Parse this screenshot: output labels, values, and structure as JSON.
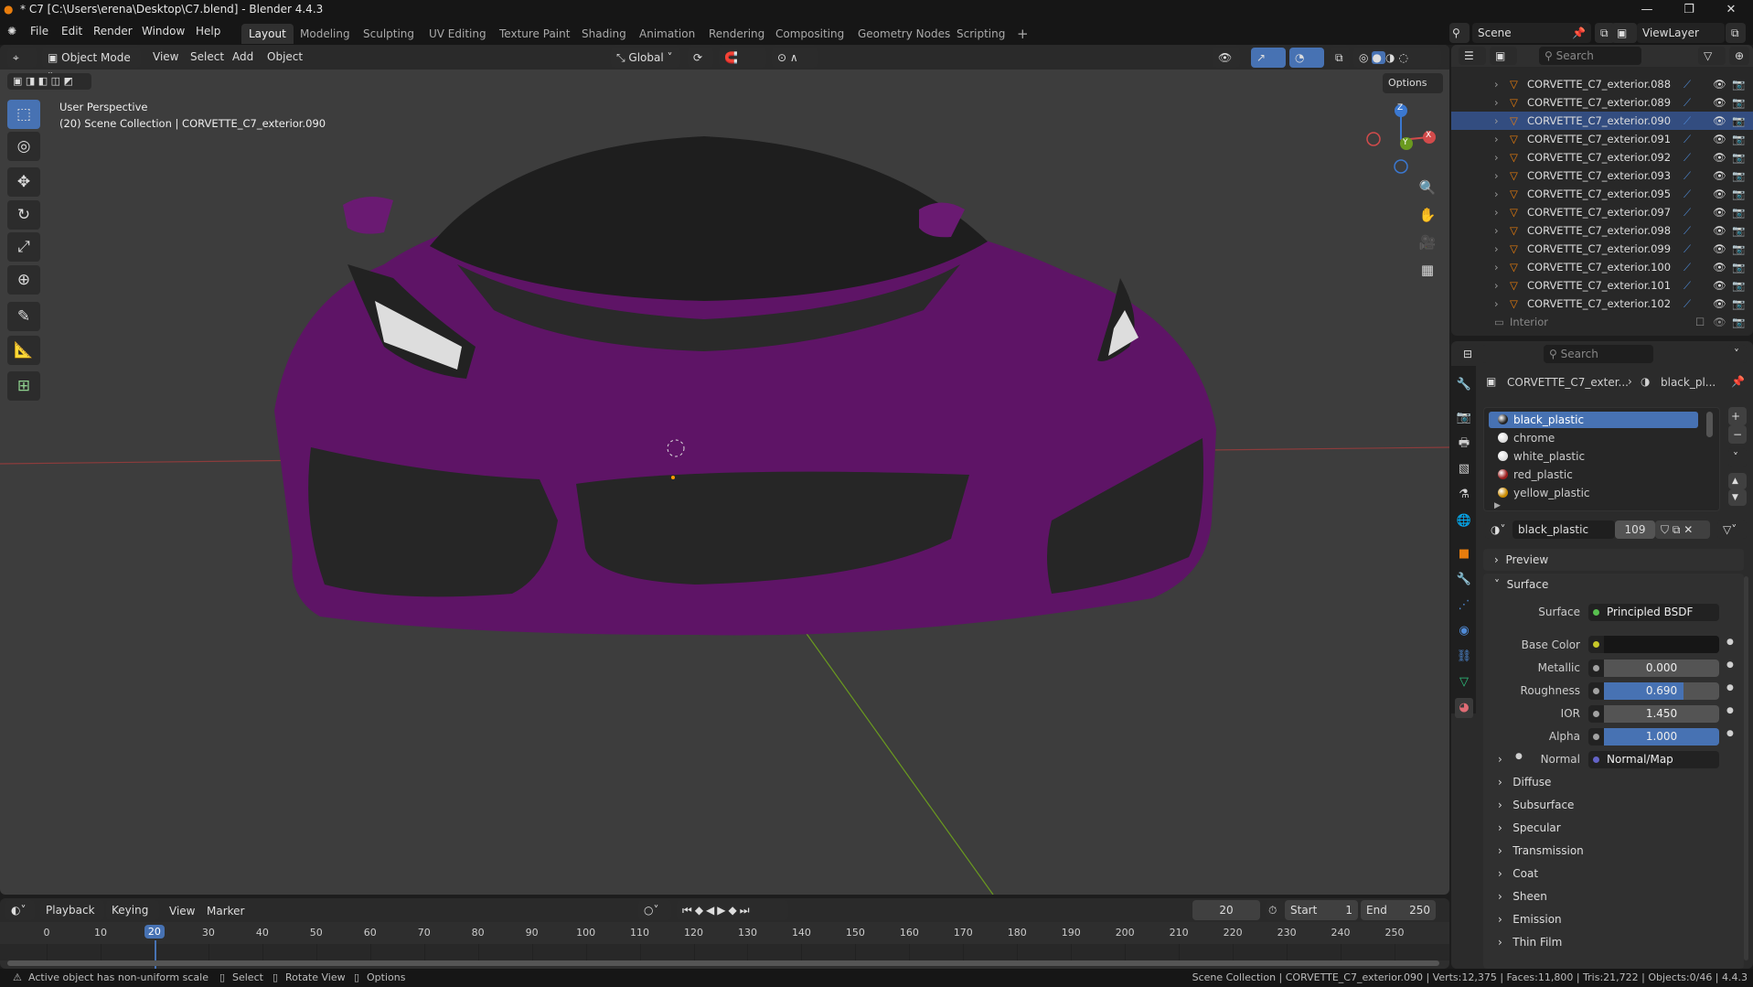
{
  "window": {
    "title": "* C7 [C:\\Users\\erena\\Desktop\\C7.blend] - Blender 4.4.3"
  },
  "menu": [
    "File",
    "Edit",
    "Render",
    "Window",
    "Help"
  ],
  "workspaces": [
    "Layout",
    "Modeling",
    "Sculpting",
    "UV Editing",
    "Texture Paint",
    "Shading",
    "Animation",
    "Rendering",
    "Compositing",
    "Geometry Nodes",
    "Scripting"
  ],
  "active_workspace": "Layout",
  "scene": {
    "name": "Scene",
    "view_layer": "ViewLayer"
  },
  "viewport": {
    "mode": "Object Mode",
    "menus": [
      "View",
      "Select",
      "Add",
      "Object"
    ],
    "orientation": "Global",
    "options": "Options",
    "overlay_title": "User Perspective",
    "overlay_subtitle": "(20) Scene Collection | CORVETTE_C7_exterior.090",
    "axes": {
      "x": "X",
      "y": "Y",
      "z": "Z"
    },
    "colors": {
      "car_paint": "#5e1466",
      "x_axis": "#9b3a3a",
      "y_axis": "#6a9a1f"
    }
  },
  "outliner": {
    "search_placeholder": "Search",
    "items": [
      "CORVETTE_C7_exterior.088",
      "CORVETTE_C7_exterior.089",
      "CORVETTE_C7_exterior.090",
      "CORVETTE_C7_exterior.091",
      "CORVETTE_C7_exterior.092",
      "CORVETTE_C7_exterior.093",
      "CORVETTE_C7_exterior.095",
      "CORVETTE_C7_exterior.097",
      "CORVETTE_C7_exterior.098",
      "CORVETTE_C7_exterior.099",
      "CORVETTE_C7_exterior.100",
      "CORVETTE_C7_exterior.101",
      "CORVETTE_C7_exterior.102"
    ],
    "selected_index": 2,
    "collection": "Interior"
  },
  "properties": {
    "search_placeholder": "Search",
    "breadcrumb_object": "CORVETTE_C7_exter...",
    "breadcrumb_material": "black_pl...",
    "materials": [
      {
        "name": "black_plastic",
        "color": "#222"
      },
      {
        "name": "chrome",
        "color": "#ddd"
      },
      {
        "name": "white_plastic",
        "color": "#e0e0e0"
      },
      {
        "name": "red_plastic",
        "color": "#9a1b1b"
      },
      {
        "name": "yellow_plastic",
        "color": "#c98a00"
      }
    ],
    "active_material": "black_plastic",
    "users": "109",
    "preview": "Preview",
    "surface_panel": "Surface",
    "surface": {
      "label": "Surface",
      "value": "Principled BSDF"
    },
    "base_color": {
      "label": "Base Color",
      "value": "#161616"
    },
    "metallic": {
      "label": "Metallic",
      "value": "0.000",
      "fraction": 0
    },
    "roughness": {
      "label": "Roughness",
      "value": "0.690",
      "fraction": 0.69
    },
    "ior": {
      "label": "IOR",
      "value": "1.450",
      "fraction": 0
    },
    "alpha": {
      "label": "Alpha",
      "value": "1.000",
      "fraction": 1
    },
    "normal": {
      "label": "Normal",
      "value": "Normal/Map"
    },
    "sections": [
      "Diffuse",
      "Subsurface",
      "Specular",
      "Transmission",
      "Coat",
      "Sheen",
      "Emission",
      "Thin Film"
    ]
  },
  "timeline": {
    "menus": [
      "Playback",
      "Keying",
      "View",
      "Marker"
    ],
    "current_frame": "20",
    "start_label": "Start",
    "start": "1",
    "end_label": "End",
    "end": "250",
    "ticks": [
      "0",
      "10",
      "20",
      "30",
      "40",
      "50",
      "60",
      "70",
      "80",
      "90",
      "100",
      "110",
      "120",
      "130",
      "140",
      "150",
      "160",
      "170",
      "180",
      "190",
      "200",
      "210",
      "220",
      "230",
      "240",
      "250"
    ]
  },
  "status": {
    "warning": "Active object has non-uniform scale",
    "hints": [
      "Select",
      "Rotate View",
      "Options"
    ],
    "info": "Scene Collection | CORVETTE_C7_exterior.090 | Verts:12,375 | Faces:11,800 | Tris:21,722 | Objects:0/46 | 4.4.3"
  }
}
